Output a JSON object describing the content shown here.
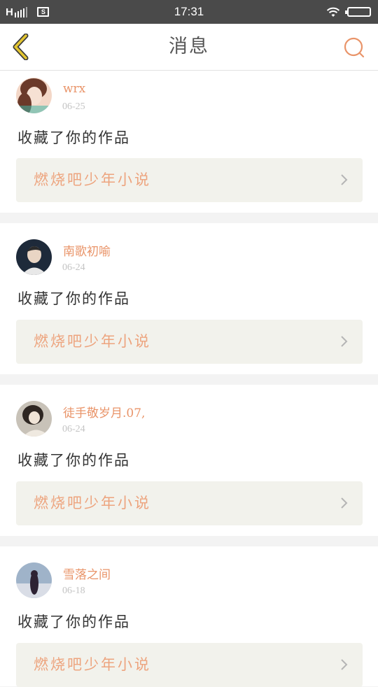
{
  "status_bar": {
    "carrier": "H",
    "time": "17:31",
    "screenshot_label": "S"
  },
  "header": {
    "title": "消息",
    "accent_color": "#e99469",
    "back_color": "#e3c530"
  },
  "messages": [
    {
      "user": "wrx",
      "date": "06-25",
      "action": "收藏了你的作品",
      "work": "燃烧吧少年小说",
      "avatar_colors": [
        "#f3d7c7",
        "#6b3a2a",
        "#c58a6c"
      ]
    },
    {
      "user": "南歌初喻",
      "date": "06-24",
      "action": "收藏了你的作品",
      "work": "燃烧吧少年小说",
      "avatar_colors": [
        "#1e2a3a",
        "#e9d5c4",
        "#2b2b2b"
      ]
    },
    {
      "user": "徒手敬岁月.07,",
      "date": "06-24",
      "action": "收藏了你的作品",
      "work": "燃烧吧少年小说",
      "avatar_colors": [
        "#c8c2b8",
        "#2e2622",
        "#efe9e0"
      ]
    },
    {
      "user": "雪落之间",
      "date": "06-18",
      "action": "收藏了你的作品",
      "work": "燃烧吧少年小说",
      "avatar_colors": [
        "#9fb3c9",
        "#2d2233",
        "#d9dde6"
      ]
    }
  ]
}
